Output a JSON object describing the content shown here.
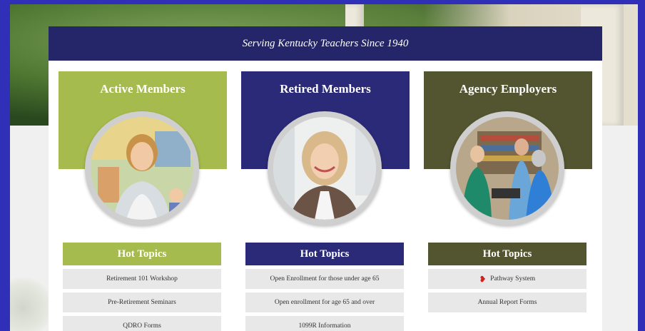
{
  "tagline": "Serving Kentucky Teachers Since 1940",
  "columns": [
    {
      "title": "Active Members",
      "color": "#a6bb4e",
      "hot_title": "Hot Topics",
      "items": [
        "Retirement 101 Workshop",
        "Pre-Retirement Seminars",
        "QDRO Forms"
      ]
    },
    {
      "title": "Retired Members",
      "color": "#2b2a78",
      "hot_title": "Hot Topics",
      "items": [
        "Open Enrollment for those under age 65",
        "Open enrollment for age 65 and over",
        "1099R Information"
      ]
    },
    {
      "title": "Agency Employers",
      "color": "#535530",
      "hot_title": "Hot Topics",
      "items": [
        "Pathway System",
        "Annual Report Forms"
      ],
      "item_icons": [
        "pathway-icon",
        ""
      ]
    }
  ]
}
